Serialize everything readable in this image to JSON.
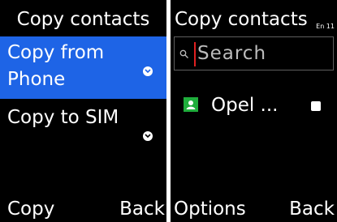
{
  "copy_screen": {
    "title": "Copy contacts",
    "options": [
      {
        "label": "Copy from Phone",
        "selected": true
      },
      {
        "label": "Copy to SIM",
        "selected": false
      }
    ],
    "softkeys": {
      "left": "Copy",
      "right": "Back"
    },
    "colors": {
      "highlight": "#1e64e6",
      "background": "#000000"
    }
  },
  "select_screen": {
    "title": "Copy contacts",
    "input_mode": "En 11",
    "search": {
      "placeholder": "Search"
    },
    "contacts": [
      {
        "name": "Opel ...",
        "checked": false
      }
    ],
    "softkeys": {
      "left": "Options",
      "right": "Back"
    },
    "colors": {
      "contact_icon": "#1fae3c",
      "caret": "#e02020"
    }
  }
}
